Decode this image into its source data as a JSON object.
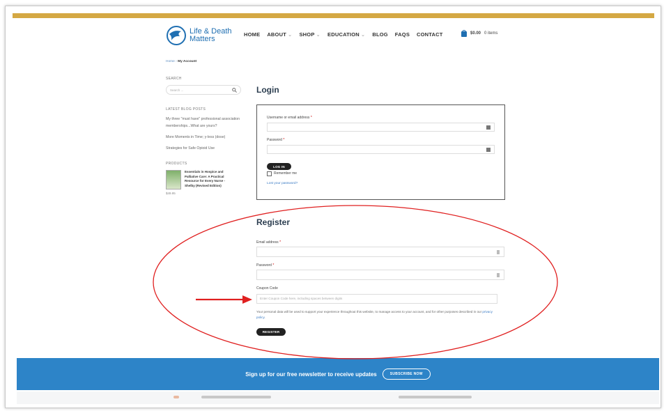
{
  "colors": {
    "gold": "#d4a843",
    "brand_blue": "#1f6fb2",
    "newsletter_bg": "#2d84c8",
    "annotation_red": "#e02020"
  },
  "logo": {
    "line1": "Life & Death",
    "line2": "Matters",
    "icon": "dove-logo-icon"
  },
  "nav": [
    {
      "label": "HOME",
      "has_dropdown": false
    },
    {
      "label": "ABOUT",
      "has_dropdown": true
    },
    {
      "label": "SHOP",
      "has_dropdown": true
    },
    {
      "label": "EDUCATION",
      "has_dropdown": true
    },
    {
      "label": "BLOG",
      "has_dropdown": false
    },
    {
      "label": "FAQS",
      "has_dropdown": false
    },
    {
      "label": "CONTACT",
      "has_dropdown": false
    }
  ],
  "cart": {
    "amount": "$0.00",
    "items": "0 items",
    "icon": "shopping-bag-icon"
  },
  "breadcrumb": {
    "home": "Home",
    "separator": "›",
    "current": "My Account"
  },
  "sidebar": {
    "search_title": "SEARCH",
    "search_placeholder": "Search ...",
    "blog_title": "LATEST BLOG POSTS",
    "blog_posts": [
      "My three \"must have\" professional association memberships...What are yours?",
      "More Moments in Time; y-less (dose)",
      "Strategies for Safe Opioid Use"
    ],
    "products_title": "PRODUCTS",
    "product_name": "Essentials in Hospice and Palliative Care: A Practical Resource for Every Nurse - Shelby (Revised Edition)",
    "product_misc": "$49.95"
  },
  "login": {
    "heading": "Login",
    "username_label": "Username or email address",
    "password_label": "Password",
    "required_mark": "*",
    "button": "LOG IN",
    "remember": "Remember me",
    "lost": "Lost your password?"
  },
  "register": {
    "heading": "Register",
    "email_label": "Email address",
    "password_label": "Password",
    "required_mark": "*",
    "coupon_label": "Coupon Code",
    "coupon_placeholder": "Enter Coupon Code here, including spaces between digits",
    "notice_text": "Your personal data will be used to support your experience throughout this website, to manage access to your account, and for other purposes described in our",
    "notice_link": "privacy policy",
    "button": "REGISTER"
  },
  "newsletter": {
    "text": "Sign up for our free newsletter to receive updates",
    "button": "SUBSCRIBE NOW"
  }
}
